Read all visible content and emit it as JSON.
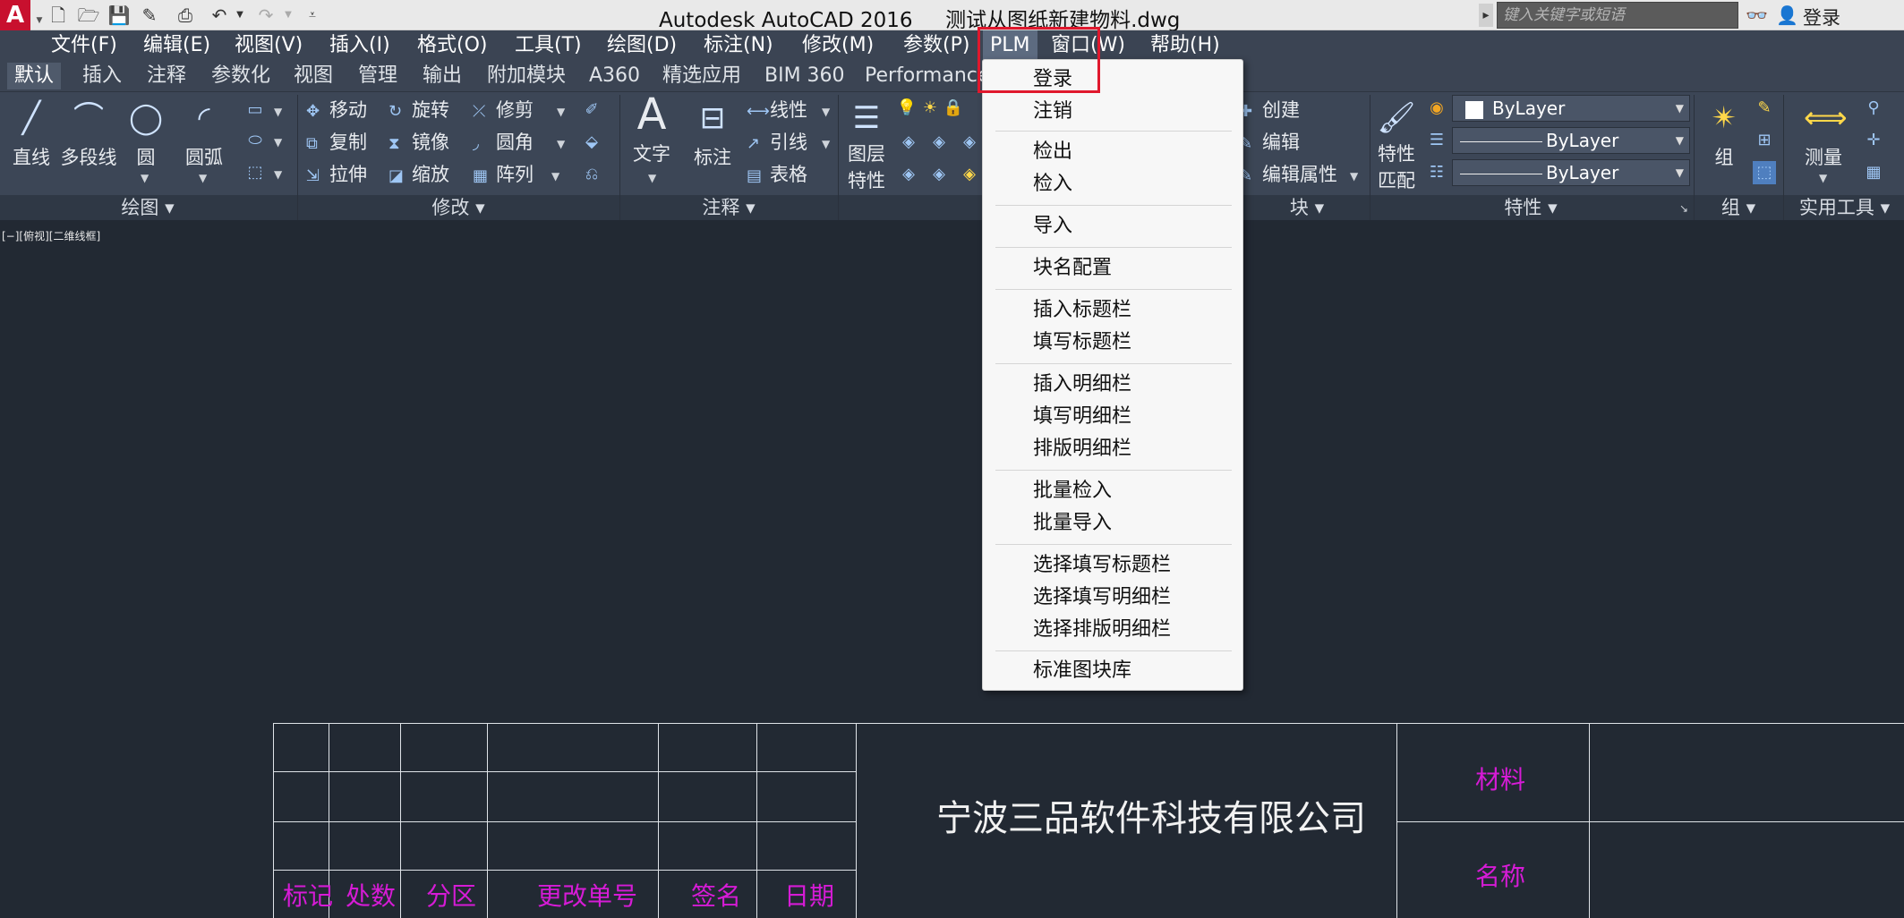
{
  "titlebar": {
    "app_logo": "A",
    "title": "Autodesk AutoCAD 2016     测试从图纸新建物料.dwg",
    "search_placeholder": "键入关键字或短语",
    "login": "登录"
  },
  "menubar": {
    "items": [
      "文件(F)",
      "编辑(E)",
      "视图(V)",
      "插入(I)",
      "格式(O)",
      "工具(T)",
      "绘图(D)",
      "标注(N)",
      "修改(M)",
      "参数(P)",
      "PLM",
      "窗口(W)",
      "帮助(H)"
    ]
  },
  "tabs": {
    "items": [
      "默认",
      "插入",
      "注释",
      "参数化",
      "视图",
      "管理",
      "输出",
      "附加模块",
      "A360",
      "精选应用",
      "BIM 360",
      "Performance"
    ]
  },
  "ribbon": {
    "draw": {
      "line": "直线",
      "polyline": "多段线",
      "circle": "圆",
      "arc": "圆弧",
      "group_label": "绘图"
    },
    "modify": {
      "move": "移动",
      "rotate": "旋转",
      "trim": "修剪",
      "copy": "复制",
      "mirror": "镜像",
      "fillet": "圆角",
      "stretch": "拉伸",
      "scale": "缩放",
      "array": "阵列",
      "group_label": "修改"
    },
    "annotation": {
      "text": "文字",
      "dimension": "标注",
      "linear": "线性",
      "leader": "引线",
      "table": "表格",
      "group_label": "注释"
    },
    "layers": {
      "layer_props_line1": "图层",
      "layer_props_line2": "特性"
    },
    "block": {
      "create": "创建",
      "edit": "编辑",
      "edit_attr": "编辑属性",
      "group_label": "块"
    },
    "properties": {
      "match_line1": "特性",
      "match_line2": "匹配",
      "color": "ByLayer",
      "linetype": "ByLayer",
      "lineweight": "ByLayer",
      "group_label": "特性"
    },
    "groups": {
      "group": "组",
      "group_label": "组"
    },
    "utilities": {
      "measure": "测量",
      "group_label": "实用工具"
    }
  },
  "viewport": {
    "view_label": "[−][俯视][二维线框]"
  },
  "titleblock": {
    "company": "宁波三品软件科技有限公司",
    "headers": [
      "标记",
      "处数",
      "分区",
      "更改单号",
      "签名",
      "日期"
    ],
    "material": "材料",
    "name": "名称"
  },
  "plm_menu": {
    "groups": [
      [
        "登录",
        "注销"
      ],
      [
        "检出",
        "检入"
      ],
      [
        "导入"
      ],
      [
        "块名配置"
      ],
      [
        "插入标题栏",
        "填写标题栏"
      ],
      [
        "插入明细栏",
        "填写明细栏",
        "排版明细栏"
      ],
      [
        "批量检入",
        "批量导入"
      ],
      [
        "选择填写标题栏",
        "选择填写明细栏",
        "选择排版明细栏"
      ],
      [
        "标准图块库"
      ]
    ]
  },
  "colors": {
    "accent_highlight": "#e0182d",
    "titleblock_text": "#d61bd6",
    "background": "#222933"
  }
}
